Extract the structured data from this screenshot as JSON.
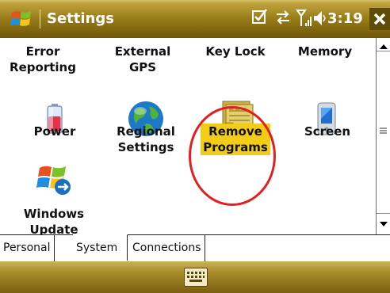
{
  "title_bar": {
    "title": "Settings",
    "time": "3:19",
    "close_label": "X"
  },
  "items": [
    {
      "label_lines": [
        "Error",
        "Reporting"
      ],
      "icon": "error-reporting-icon"
    },
    {
      "label_lines": [
        "External",
        "GPS"
      ],
      "icon": "gps-icon"
    },
    {
      "label_lines": [
        "Key Lock"
      ],
      "icon": "key-lock-icon"
    },
    {
      "label_lines": [
        "Memory"
      ],
      "icon": "memory-icon"
    },
    {
      "label_lines": [
        "Power"
      ],
      "icon": "battery-icon"
    },
    {
      "label_lines": [
        "Regional",
        "Settings"
      ],
      "icon": "globe-icon"
    },
    {
      "label_lines": [
        "Remove",
        "Programs"
      ],
      "icon": "remove-programs-icon",
      "selected": true
    },
    {
      "label_lines": [
        "Screen"
      ],
      "icon": "screen-icon"
    },
    {
      "label_lines": [
        "Windows",
        "Update"
      ],
      "icon": "windows-update-icon"
    }
  ],
  "tabs": [
    {
      "label": "Personal",
      "active": false
    },
    {
      "label": "System",
      "active": true
    },
    {
      "label": "Connections",
      "active": false
    }
  ],
  "colors": {
    "title_bar": "#9b7f1a",
    "selection_highlight": "#f2cc16",
    "annotation_ring": "#e21f1f"
  }
}
